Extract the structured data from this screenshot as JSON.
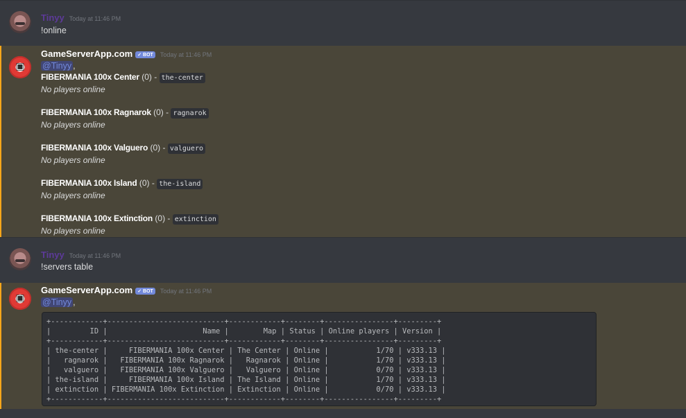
{
  "messages": [
    {
      "author": "Tinyy",
      "timestamp": "Today at 11:46 PM",
      "content": "!online"
    },
    {
      "author": "GameServerApp.com",
      "bot_tag": "BOT",
      "timestamp": "Today at 11:46 PM",
      "mention": "@Tinyy",
      "mention_suffix": ",",
      "servers": [
        {
          "name": "FIBERMANIA 100x Center",
          "count": "(0) -",
          "map_code": "the-center",
          "status": "No players online"
        },
        {
          "name": "FIBERMANIA 100x Ragnarok",
          "count": "(0) -",
          "map_code": "ragnarok",
          "status": "No players online"
        },
        {
          "name": "FIBERMANIA 100x Valguero",
          "count": "(0) -",
          "map_code": "valguero",
          "status": "No players online"
        },
        {
          "name": "FIBERMANIA 100x Island",
          "count": "(0) -",
          "map_code": "the-island",
          "status": "No players online"
        },
        {
          "name": "FIBERMANIA 100x Extinction",
          "count": "(0) -",
          "map_code": "extinction",
          "status": "No players online"
        }
      ]
    },
    {
      "author": "Tinyy",
      "timestamp": "Today at 11:46 PM",
      "content": "!servers table"
    },
    {
      "author": "GameServerApp.com",
      "bot_tag": "BOT",
      "timestamp": "Today at 11:46 PM",
      "mention": "@Tinyy",
      "mention_suffix": ",",
      "table_text": "+------------+---------------------------+------------+--------+----------------+---------+\n|         ID |                      Name |        Map | Status | Online players | Version |\n+------------+---------------------------+------------+--------+----------------+---------+\n| the-center |     FIBERMANIA 100x Center | The Center | Online |           1/70 | v333.13 |\n|   ragnarok |   FIBERMANIA 100x Ragnarok |   Ragnarok | Online |           1/70 | v333.13 |\n|   valguero |   FIBERMANIA 100x Valguero |   Valguero | Online |           0/70 | v333.13 |\n| the-island |     FIBERMANIA 100x Island | The Island | Online |           1/70 | v333.13 |\n| extinction | FIBERMANIA 100x Extinction | Extinction | Online |           0/70 | v333.13 |\n+------------+---------------------------+------------+--------+----------------+---------+"
    }
  ],
  "colors": {
    "background": "#36393f",
    "mention_highlight": "#4a4639",
    "mention_bar": "#faa61a",
    "bot_tag": "#7289da",
    "user_name": "#5d3a99"
  }
}
